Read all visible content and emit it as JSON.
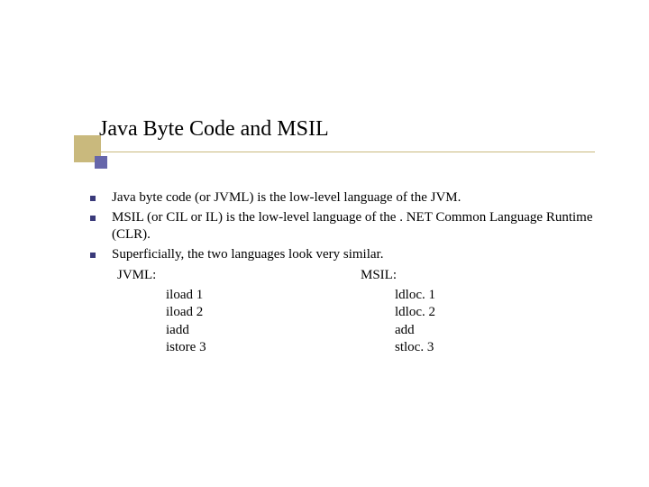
{
  "title": "Java Byte Code and MSIL",
  "bullets": [
    "Java byte code (or JVML) is the low-level language of the JVM.",
    "MSIL (or CIL or IL) is the low-level language of the . NET Common Language Runtime (CLR).",
    "Superficially, the two languages look very similar."
  ],
  "jvml": {
    "label": "JVML:",
    "lines": [
      "iload 1",
      "iload 2",
      "iadd",
      "istore 3"
    ]
  },
  "msil": {
    "label": "MSIL:",
    "lines": [
      "ldloc. 1",
      "ldloc. 2",
      "add",
      "stloc. 3"
    ]
  }
}
